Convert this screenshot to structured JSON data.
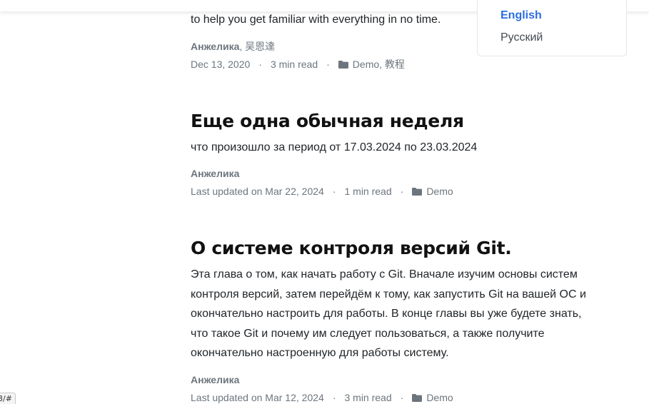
{
  "language_menu": {
    "items": [
      {
        "label": "English",
        "active": true
      },
      {
        "label": "Русский",
        "active": false
      }
    ]
  },
  "posts": [
    {
      "summary_tail": "to help you get familiar with everything in no time.",
      "author_bold": "Анжелика",
      "author_rest": ", 吴恩達",
      "date": "Dec 13, 2020",
      "read_time": "3 min read",
      "category": "Demo, 教程"
    },
    {
      "title": "Еще одна обычная неделя",
      "summary": "что произошло за период от 17.03.2024 по 23.03.2024",
      "author_bold": "Анжелика",
      "date": "Last updated on Mar 22, 2024",
      "read_time": "1 min read",
      "category": "Demo"
    },
    {
      "title": "О системе контроля версий Git.",
      "summary_lines": [
        "Эта глава о том, как начать работу с Git. Вначале изучим основы систем",
        "контроля версий, затем перейдём к тому, как запустить Git на вашей ОС и",
        "окончательно настроить для работы. В конце главы вы уже будете знать,",
        "что такое Git и почему им следует пользоваться, а также получите",
        "окончательно настроенную для работы систему."
      ],
      "author_bold": "Анжелика",
      "date": "Last updated on Mar 12, 2024",
      "read_time": "3 min read",
      "category": "Demo"
    }
  ],
  "separator": "·",
  "status_url": "3/#",
  "colors": {
    "accent": "#2b6de3",
    "meta": "#6c757d",
    "text": "#212529"
  }
}
